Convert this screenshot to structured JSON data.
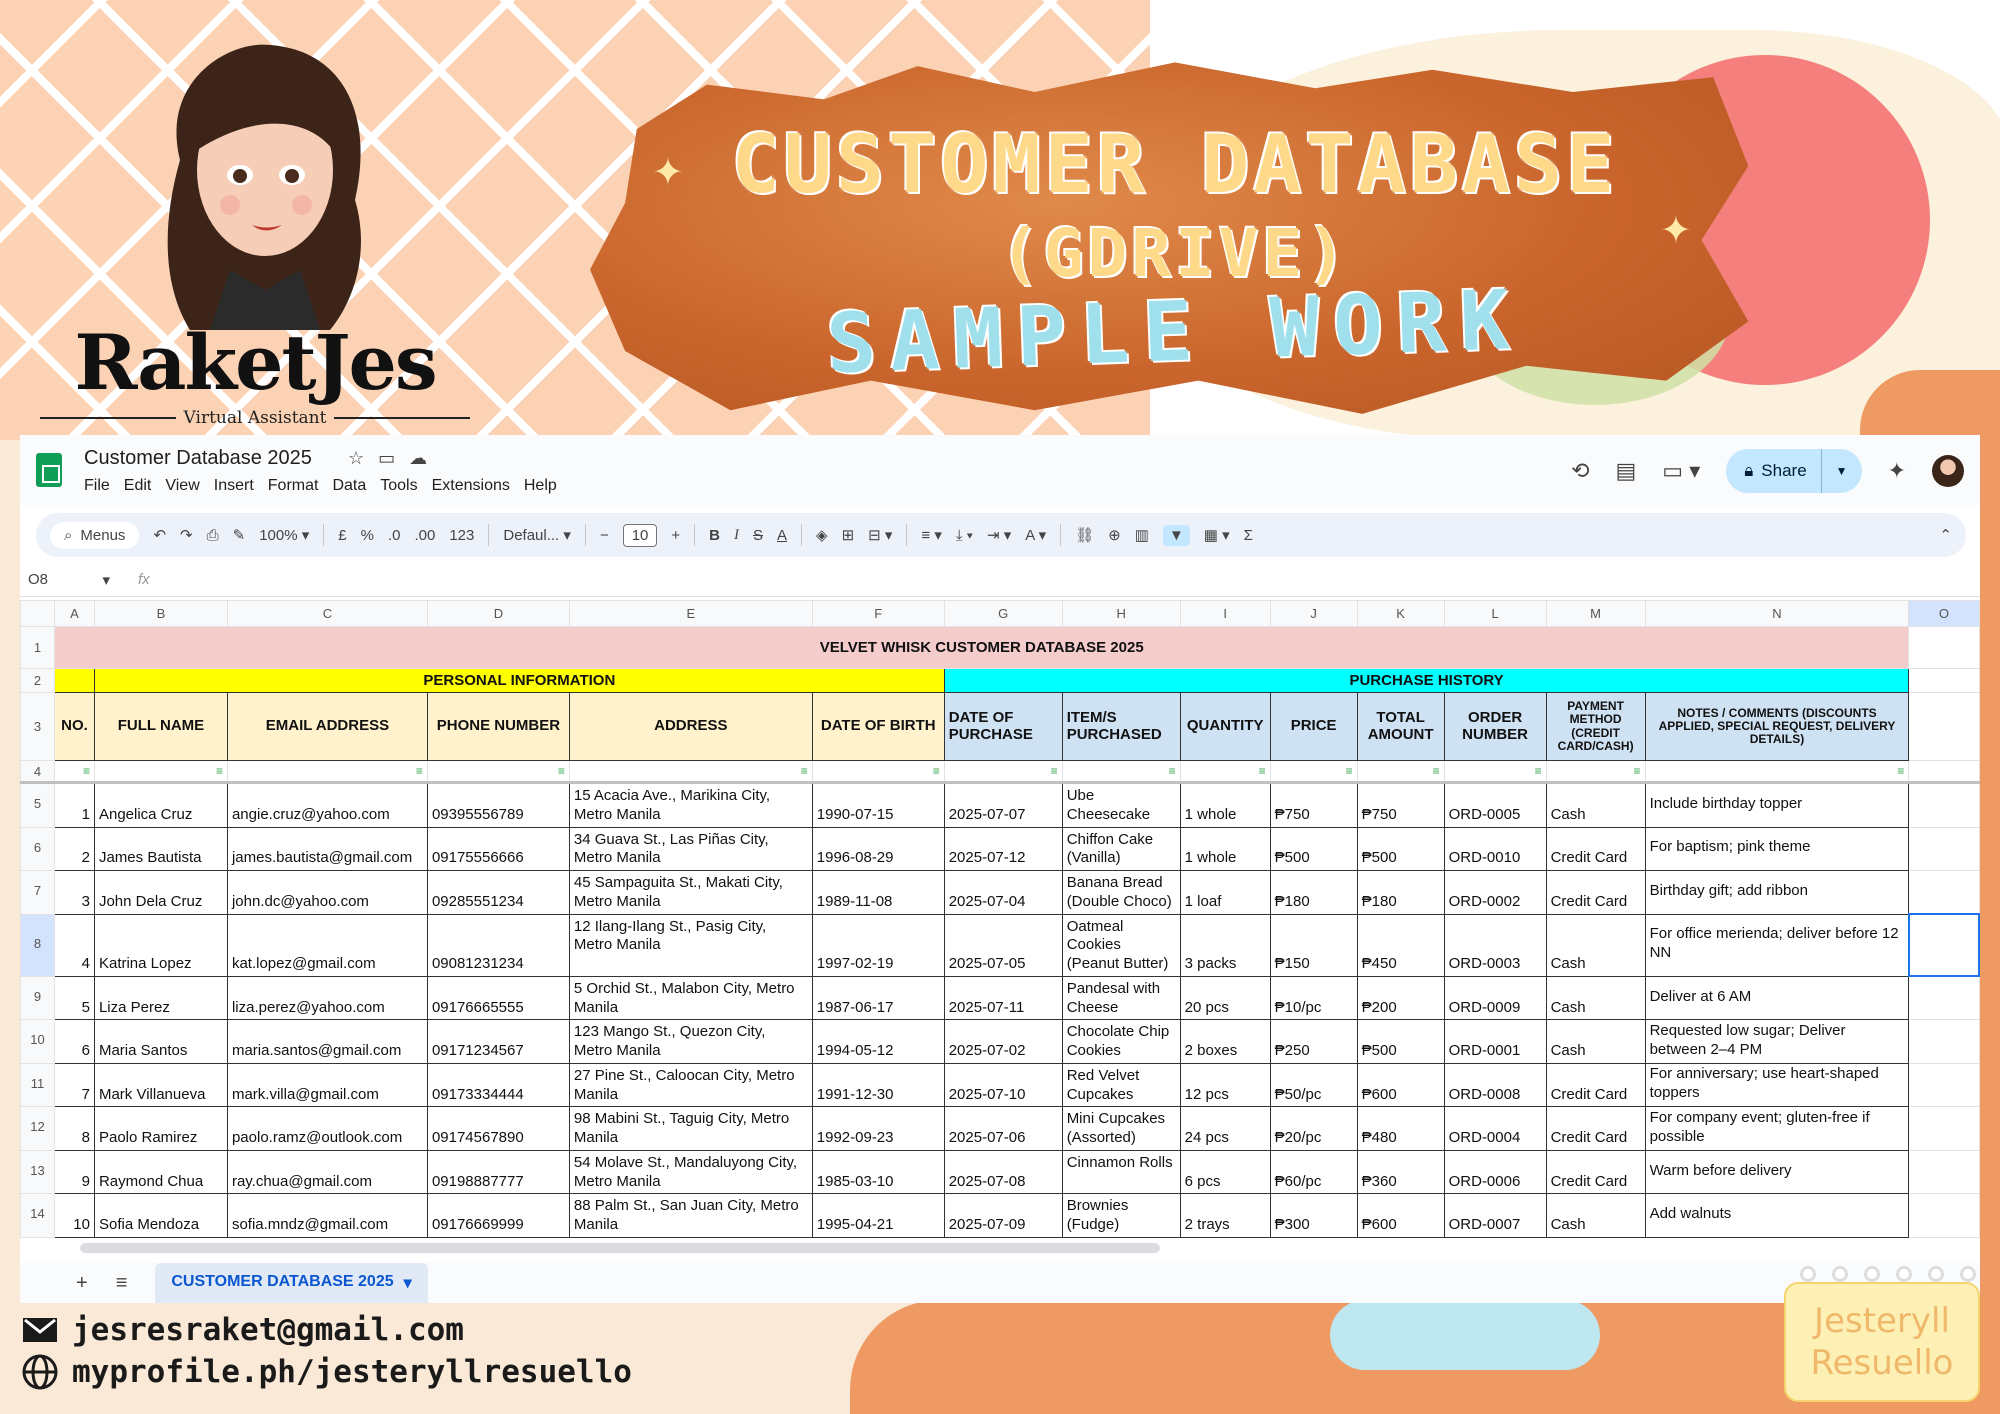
{
  "poster": {
    "title_line1": "CUSTOMER DATABASE",
    "title_line2": "(GDRIVE)",
    "title_line3": "SAMPLE WORK",
    "brand_name": "RaketJes",
    "brand_tagline": "Virtual Assistant",
    "contact_email": "jesresraket@gmail.com",
    "contact_web": "myprofile.ph/jesteryllresuello",
    "watermark_line1": "Jesteryll",
    "watermark_line2": "Resuello"
  },
  "app": {
    "doc_title": "Customer Database 2025",
    "menu": [
      "File",
      "Edit",
      "View",
      "Insert",
      "Format",
      "Data",
      "Tools",
      "Extensions",
      "Help"
    ],
    "share_label": "Share",
    "toolbar": {
      "menus_label": "Menus",
      "zoom": "100%",
      "currency": "£",
      "percent": "%",
      "dec_decrease": ".0",
      "dec_increase": ".00",
      "number_format": "123",
      "font": "Defaul...",
      "font_size": "10"
    },
    "name_box": "O8",
    "fx_label": "fx",
    "sheet_tab": "CUSTOMER DATABASE 2025"
  },
  "sheet": {
    "columns": [
      "A",
      "B",
      "C",
      "D",
      "E",
      "F",
      "G",
      "H",
      "I",
      "J",
      "K",
      "L",
      "M",
      "N",
      "O"
    ],
    "row_numbers": [
      "1",
      "2",
      "3",
      "4",
      "5",
      "6",
      "7",
      "8",
      "9",
      "10",
      "11",
      "12",
      "13",
      "14"
    ],
    "banner": "VELVET WHISK CUSTOMER DATABASE 2025",
    "section_personal": "PERSONAL INFORMATION",
    "section_purchase": "PURCHASE HISTORY",
    "headers": {
      "no": "NO.",
      "full_name": "FULL NAME",
      "email": "EMAIL ADDRESS",
      "phone": "PHONE NUMBER",
      "address": "ADDRESS",
      "dob": "DATE OF BIRTH",
      "date_purchase": "DATE OF PURCHASE",
      "items": "ITEM/S PURCHASED",
      "quantity": "QUANTITY",
      "price": "PRICE",
      "total": "TOTAL AMOUNT",
      "order_no": "ORDER NUMBER",
      "payment": "PAYMENT METHOD (CREDIT CARD/CASH)",
      "notes": "NOTES / COMMENTS (DISCOUNTS APPLIED, SPECIAL REQUEST, DELIVERY DETAILS)"
    },
    "rows": [
      {
        "no": "1",
        "name": "Angelica Cruz",
        "email": "angie.cruz@yahoo.com",
        "phone": "09395556789",
        "address": "15 Acacia Ave., Marikina City, Metro Manila",
        "dob": "1990-07-15",
        "date": "2025-07-07",
        "item": "Ube Cheesecake",
        "qty": "1 whole",
        "price": "₱750",
        "total": "₱750",
        "order": "ORD-0005",
        "payment": "Cash",
        "notes": "Include birthday topper"
      },
      {
        "no": "2",
        "name": "James Bautista",
        "email": "james.bautista@gmail.com",
        "phone": "09175556666",
        "address": "34 Guava St., Las Piñas City, Metro Manila",
        "dob": "1996-08-29",
        "date": "2025-07-12",
        "item": "Chiffon Cake (Vanilla)",
        "qty": "1 whole",
        "price": "₱500",
        "total": "₱500",
        "order": "ORD-0010",
        "payment": "Credit Card",
        "notes": "For baptism; pink theme"
      },
      {
        "no": "3",
        "name": "John Dela Cruz",
        "email": "john.dc@yahoo.com",
        "phone": "09285551234",
        "address": "45 Sampaguita St., Makati City, Metro Manila",
        "dob": "1989-11-08",
        "date": "2025-07-04",
        "item": "Banana Bread (Double Choco)",
        "qty": "1 loaf",
        "price": "₱180",
        "total": "₱180",
        "order": "ORD-0002",
        "payment": "Credit Card",
        "notes": "Birthday gift; add ribbon"
      },
      {
        "no": "4",
        "name": "Katrina Lopez",
        "email": "kat.lopez@gmail.com",
        "phone": "09081231234",
        "address": "12 Ilang-Ilang St., Pasig City, Metro Manila",
        "dob": "1997-02-19",
        "date": "2025-07-05",
        "item": "Oatmeal Cookies (Peanut Butter)",
        "qty": "3 packs",
        "price": "₱150",
        "total": "₱450",
        "order": "ORD-0003",
        "payment": "Cash",
        "notes": "For office merienda; deliver before 12 NN"
      },
      {
        "no": "5",
        "name": "Liza Perez",
        "email": "liza.perez@yahoo.com",
        "phone": "09176665555",
        "address": "5 Orchid St., Malabon City, Metro Manila",
        "dob": "1987-06-17",
        "date": "2025-07-11",
        "item": "Pandesal with Cheese",
        "qty": "20 pcs",
        "price": "₱10/pc",
        "total": "₱200",
        "order": "ORD-0009",
        "payment": "Cash",
        "notes": "Deliver at 6 AM"
      },
      {
        "no": "6",
        "name": "Maria Santos",
        "email": "maria.santos@gmail.com",
        "phone": "09171234567",
        "address": "123 Mango St., Quezon City, Metro Manila",
        "dob": "1994-05-12",
        "date": "2025-07-02",
        "item": "Chocolate Chip Cookies",
        "qty": "2 boxes",
        "price": "₱250",
        "total": "₱500",
        "order": "ORD-0001",
        "payment": "Cash",
        "notes": "Requested low sugar; Deliver between 2–4 PM"
      },
      {
        "no": "7",
        "name": "Mark Villanueva",
        "email": "mark.villa@gmail.com",
        "phone": "09173334444",
        "address": "27 Pine St., Caloocan City, Metro Manila",
        "dob": "1991-12-30",
        "date": "2025-07-10",
        "item": "Red Velvet Cupcakes",
        "qty": "12 pcs",
        "price": "₱50/pc",
        "total": "₱600",
        "order": "ORD-0008",
        "payment": "Credit Card",
        "notes": "For anniversary; use heart-shaped toppers"
      },
      {
        "no": "8",
        "name": "Paolo Ramirez",
        "email": "paolo.ramz@outlook.com",
        "phone": "09174567890",
        "address": "98 Mabini St., Taguig City, Metro Manila",
        "dob": "1992-09-23",
        "date": "2025-07-06",
        "item": "Mini Cupcakes (Assorted)",
        "qty": "24 pcs",
        "price": "₱20/pc",
        "total": "₱480",
        "order": "ORD-0004",
        "payment": "Credit Card",
        "notes": "For company event; gluten-free if possible"
      },
      {
        "no": "9",
        "name": "Raymond Chua",
        "email": "ray.chua@gmail.com",
        "phone": "09198887777",
        "address": "54 Molave St., Mandaluyong City, Metro Manila",
        "dob": "1985-03-10",
        "date": "2025-07-08",
        "item": "Cinnamon Rolls",
        "qty": "6 pcs",
        "price": "₱60/pc",
        "total": "₱360",
        "order": "ORD-0006",
        "payment": "Credit Card",
        "notes": "Warm before delivery"
      },
      {
        "no": "10",
        "name": "Sofia Mendoza",
        "email": "sofia.mndz@gmail.com",
        "phone": "09176669999",
        "address": "88 Palm St., San Juan City, Metro Manila",
        "dob": "1995-04-21",
        "date": "2025-07-09",
        "item": "Brownies (Fudge)",
        "qty": "2 trays",
        "price": "₱300",
        "total": "₱600",
        "order": "ORD-0007",
        "payment": "Cash",
        "notes": "Add walnuts"
      }
    ]
  }
}
